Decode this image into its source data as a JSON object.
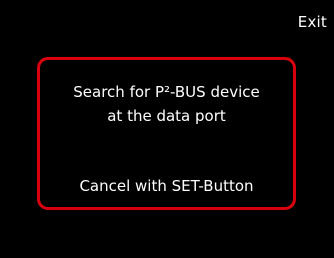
{
  "header": {
    "exit_label": "Exit"
  },
  "dialog": {
    "message_line1": "Search for P²-BUS device",
    "message_line2": "at the data port",
    "cancel_hint": "Cancel with SET-Button"
  },
  "colors": {
    "background": "#000000",
    "text": "#ffffff",
    "dialog_border": "#d8000f"
  }
}
